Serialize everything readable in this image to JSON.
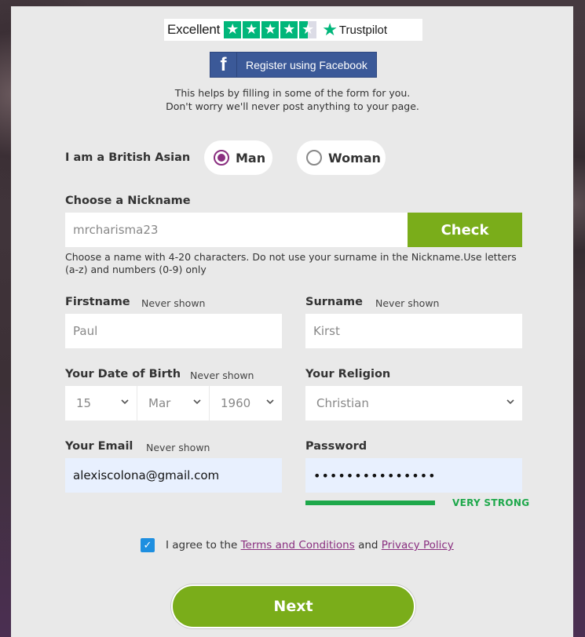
{
  "trustpilot": {
    "rating_label": "Excellent",
    "brand": "Trustpilot",
    "stars": 4.5
  },
  "facebook": {
    "icon_text": "f",
    "label": "Register using Facebook"
  },
  "fb_note": {
    "line1": "This helps by filling in some of the form for you.",
    "line2": "Don't worry we'll never post anything to your page."
  },
  "gender": {
    "label": "I am a British Asian",
    "options": [
      "Man",
      "Woman"
    ],
    "selected": "Man"
  },
  "nickname": {
    "label": "Choose a Nickname",
    "value": "mrcharisma23",
    "check_label": "Check",
    "hint": "Choose a name with 4-20 characters. Do not use your surname in the Nickname.Use letters (a-z) and numbers (0-9) only"
  },
  "firstname": {
    "label": "Firstname",
    "note": "Never shown",
    "placeholder": "Paul"
  },
  "surname": {
    "label": "Surname",
    "note": "Never shown",
    "placeholder": "Kirst"
  },
  "dob": {
    "label": "Your Date of Birth",
    "note": "Never shown",
    "day": "15",
    "month": "Mar",
    "year": "1960"
  },
  "religion": {
    "label": "Your Religion",
    "value": "Christian"
  },
  "email": {
    "label": "Your Email",
    "note": "Never shown",
    "value": "alexiscolona@gmail.com"
  },
  "password": {
    "label": "Password",
    "value": "•••••••••••••••",
    "strength": "VERY STRONG",
    "strength_color": "#1ea84b"
  },
  "agree": {
    "prefix": "I agree to the",
    "terms": "Terms and Conditions",
    "and": "and",
    "privacy": "Privacy Policy"
  },
  "next_label": "Next",
  "colors": {
    "accent_green": "#7aad1a",
    "brand_purple": "#8a2f80",
    "facebook_blue": "#3b5998",
    "trustpilot_green": "#00b67a"
  }
}
